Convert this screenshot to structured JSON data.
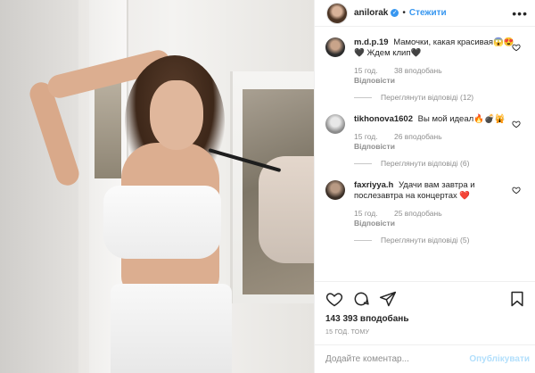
{
  "header": {
    "username": "anilorak",
    "verified_icon": "verified-badge-icon",
    "separator": "•",
    "follow_label": "Стежити",
    "more_icon": "more-options-icon"
  },
  "comments": [
    {
      "username": "m.d.p.19",
      "text": "Мамочки, какая красивая😱😍🖤 Ждем клип🖤",
      "age": "15 год.",
      "likes": "38 вподобань",
      "reply_label": "Відповісти",
      "replies_label": "Переглянути відповіді (12)"
    },
    {
      "username": "tikhonova1602",
      "text": "Вы мой идеал🔥💣🙀",
      "age": "15 год.",
      "likes": "26 вподобань",
      "reply_label": "Відповісти",
      "replies_label": "Переглянути відповіді (6)"
    },
    {
      "username": "faxriyya.h",
      "text": "Удачи вам завтра и послезавтра на концертах ❤️",
      "age": "15 год.",
      "likes": "25 вподобань",
      "reply_label": "Відповісти",
      "replies_label": "Переглянути відповіді (5)"
    }
  ],
  "actions": {
    "icons": [
      "like-icon",
      "comment-icon",
      "share-icon",
      "save-icon"
    ],
    "likes_count": "143 393 вподобань",
    "time_ago": "15 ГОД. ТОМУ"
  },
  "composer": {
    "placeholder": "Додайте коментар...",
    "publish_label": "Опублікувати"
  },
  "colors": {
    "link_blue": "#3897f0",
    "muted_gray": "#8e8e8e",
    "publish_disabled": "#b2dffc"
  }
}
